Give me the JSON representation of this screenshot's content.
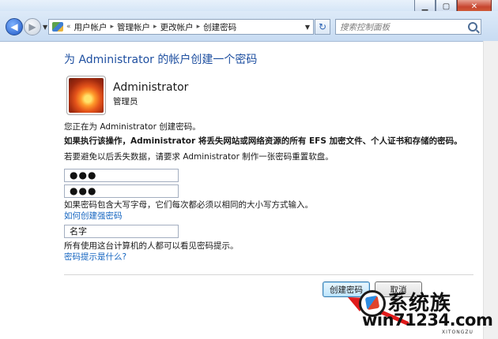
{
  "window": {
    "min_glyph": "▁",
    "max_glyph": "▢",
    "close_glyph": "✕"
  },
  "nav": {
    "back_glyph": "◀",
    "fwd_glyph": "▶",
    "dropdown_glyph": "▼",
    "breadcrumb_prefix": "«",
    "breadcrumbs": [
      "用户帐户",
      "管理帐户",
      "更改帐户",
      "创建密码"
    ],
    "refresh_glyph": "↻",
    "search_placeholder": "搜索控制面板"
  },
  "main": {
    "heading": "为 Administrator 的帐户创建一个密码",
    "user_name": "Administrator",
    "user_role": "管理员",
    "info_line": "您正在为 Administrator 创建密码。",
    "warning_line": "如果执行该操作，Administrator 将丢失网站或网络资源的所有 EFS 加密文件、个人证书和存储的密码。",
    "reset_disk_line": "若要避免以后丢失数据，请要求 Administrator 制作一张密码重置软盘。",
    "password_value": "●●●",
    "confirm_value": "●●●",
    "case_hint": "如果密码包含大写字母，它们每次都必须以相同的大小写方式输入。",
    "strong_password_link": "如何创建强密码",
    "hint_value": "名字",
    "hint_visibility_note": "所有使用这台计算机的人都可以看见密码提示。",
    "hint_help_link": "密码提示是什么?",
    "create_button": "创建密码",
    "cancel_button": "取消"
  },
  "watermark": {
    "brand": "系统族",
    "url": "win71234.com",
    "sub": "XITONGZU"
  },
  "colors": {
    "heading": "#1e4fa0",
    "link": "#1565c0",
    "annotation_arrow": "#e01b1b"
  }
}
